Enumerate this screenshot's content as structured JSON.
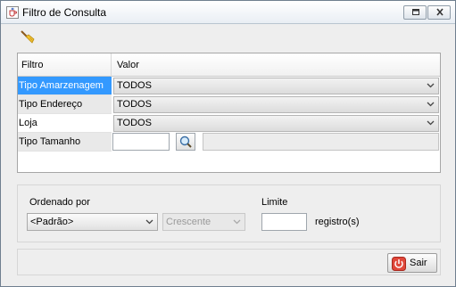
{
  "window": {
    "title": "Filtro de Consulta",
    "icons": [
      "java-cup-icon",
      "restore-icon",
      "close-icon"
    ]
  },
  "toolbar": {
    "icon": "broom-icon"
  },
  "grid": {
    "headers": {
      "filtro": "Filtro",
      "valor": "Valor"
    },
    "rows": [
      {
        "label": "Tipo Amarzenagem",
        "value": "TODOS",
        "selected": true
      },
      {
        "label": "Tipo Endereço",
        "value": "TODOS"
      },
      {
        "label": "Loja",
        "value": "TODOS"
      },
      {
        "label": "Tipo Tamanho",
        "input_value": "",
        "description": ""
      }
    ]
  },
  "order": {
    "label": "Ordenado por",
    "selected": "<Padrão>",
    "direction": "Crescente",
    "limit_label": "Limite",
    "limit_value": "",
    "limit_suffix": "registro(s)"
  },
  "footer": {
    "exit_label": "Sair"
  },
  "colors": {
    "selection": "#3399ff",
    "exit_icon": "#e0473a"
  }
}
